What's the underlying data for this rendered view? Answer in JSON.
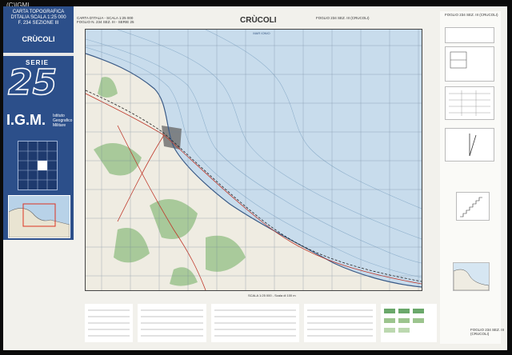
{
  "copyright": "(C)IGMI",
  "cover": {
    "title": "CARTA TOPOGRAFICA D'ITALIA SCALA 1:25 000",
    "sheet_ref": "F. 234 SEZIONE III",
    "place": "CRÙCOLI",
    "serie": "SERIE",
    "serie_number": "25",
    "logo": "I.G.M.",
    "institute": "Istituto Geografico Militare"
  },
  "map": {
    "title": "CRÙCOLI",
    "header_left": "CARTA D'ITALIA - SCALA 1:25 000",
    "header_left_sub": "FOGLIO N. 234 SEZ. III - SERIE 25",
    "header_right": "FOGLIO 234 SEZ. III (CRUCOLI)",
    "sea_label": "MAR IONIO",
    "scale_bar": "SCALA 1:25 000 - Scala di 100 m"
  },
  "sidebar": {
    "header": "FOGLIO 234 SEZ. III (CRUCOLI)"
  },
  "footer": {
    "sheet_number": "FOGLIO 234 SEZ. III (CRUCOLI)"
  },
  "colors": {
    "sea": "#c8dcec",
    "land": "#efece2",
    "vegetation": "#9cc48e",
    "cover_blue": "#2c4f8a"
  }
}
